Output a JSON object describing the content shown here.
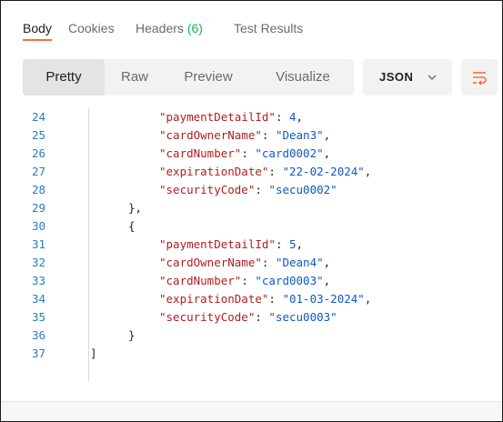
{
  "tabs": [
    {
      "label": "Body",
      "count": ""
    },
    {
      "label": "Cookies",
      "count": ""
    },
    {
      "label": "Headers",
      "count": "(6)"
    },
    {
      "label": "Test Results",
      "count": ""
    }
  ],
  "toolbar": {
    "views": [
      "Pretty",
      "Raw",
      "Preview",
      "Visualize"
    ],
    "active_view": "Pretty",
    "format": "JSON",
    "wrap_icon": "wrap-lines-icon"
  },
  "colors": {
    "accent": "#ff6c37",
    "count_green": "#0cbb52",
    "line_number": "#2b7dbb",
    "key": "#b21e1e",
    "string": "#0f59c4"
  },
  "code_lines": [
    {
      "n": "24",
      "indent": 2,
      "key": "\"paymentDetailId\"",
      "sep": ": ",
      "val": "4",
      "trail": ","
    },
    {
      "n": "25",
      "indent": 2,
      "key": "\"cardOwnerName\"",
      "sep": ": ",
      "val": "\"Dean3\"",
      "trail": ","
    },
    {
      "n": "26",
      "indent": 2,
      "key": "\"cardNumber\"",
      "sep": ": ",
      "val": "\"card0002\"",
      "trail": ","
    },
    {
      "n": "27",
      "indent": 2,
      "key": "\"expirationDate\"",
      "sep": ": ",
      "val": "\"22-02-2024\"",
      "trail": ","
    },
    {
      "n": "28",
      "indent": 2,
      "key": "\"securityCode\"",
      "sep": ": ",
      "val": "\"secu0002\"",
      "trail": ""
    },
    {
      "n": "29",
      "indent": 1,
      "key": "",
      "sep": "",
      "val": "",
      "trail": "},"
    },
    {
      "n": "30",
      "indent": 1,
      "key": "",
      "sep": "",
      "val": "",
      "trail": "{"
    },
    {
      "n": "31",
      "indent": 2,
      "key": "\"paymentDetailId\"",
      "sep": ": ",
      "val": "5",
      "trail": ","
    },
    {
      "n": "32",
      "indent": 2,
      "key": "\"cardOwnerName\"",
      "sep": ": ",
      "val": "\"Dean4\"",
      "trail": ","
    },
    {
      "n": "33",
      "indent": 2,
      "key": "\"cardNumber\"",
      "sep": ": ",
      "val": "\"card0003\"",
      "trail": ","
    },
    {
      "n": "34",
      "indent": 2,
      "key": "\"expirationDate\"",
      "sep": ": ",
      "val": "\"01-03-2024\"",
      "trail": ","
    },
    {
      "n": "35",
      "indent": 2,
      "key": "\"securityCode\"",
      "sep": ": ",
      "val": "\"secu0003\"",
      "trail": ""
    },
    {
      "n": "36",
      "indent": 1,
      "key": "",
      "sep": "",
      "val": "",
      "trail": "}"
    },
    {
      "n": "37",
      "indent": 0,
      "key": "",
      "sep": "",
      "val": "",
      "trail": "]"
    }
  ]
}
